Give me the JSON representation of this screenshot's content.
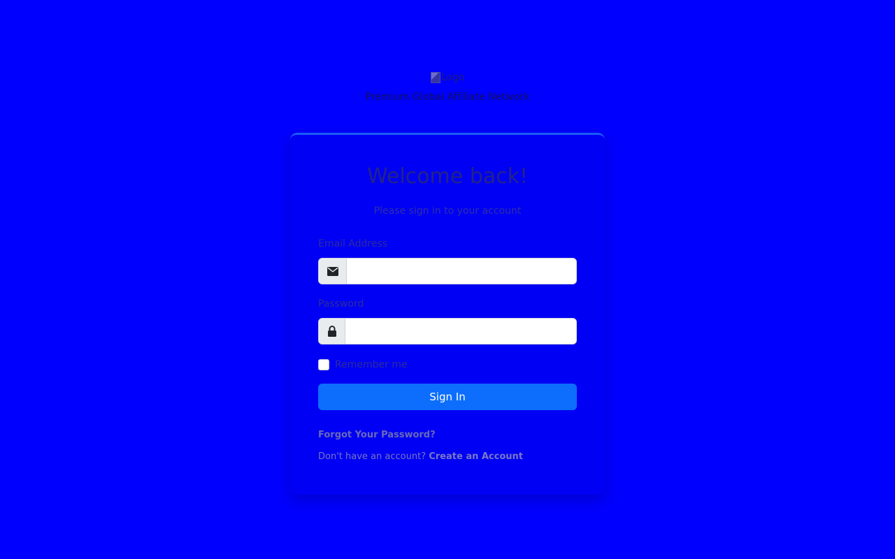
{
  "brand": {
    "logo_alt": "Logo",
    "tagline": "Premium Global Affiliate Network"
  },
  "card": {
    "title": "Welcome back!",
    "subtitle": "Please sign in to your account"
  },
  "form": {
    "email_label": "Email Address",
    "email_value": "",
    "email_icon": "envelope-icon",
    "password_label": "Password",
    "password_value": "",
    "password_icon": "lock-icon",
    "remember_label": "Remember me",
    "remember_checked": false,
    "submit_label": "Sign In"
  },
  "links": {
    "forgot": "Forgot Your Password?",
    "register_prompt": "Don't have an account?",
    "register": "Create an Account"
  },
  "colors": {
    "background": "#0000ff",
    "primary_button": "#0d6efd",
    "card_accent": "#1c5cf8"
  }
}
